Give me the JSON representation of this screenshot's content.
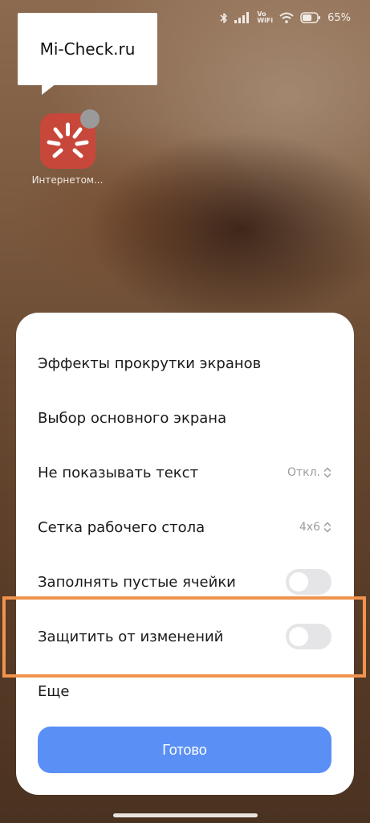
{
  "status_bar": {
    "vo_label": "Vo",
    "wifi_label": "WiFi",
    "battery_percent": "65",
    "battery_level": 0.65
  },
  "watermark": {
    "text": "Mi-Check.ru"
  },
  "app": {
    "label": "Интернетом..."
  },
  "settings_sheet": {
    "items": [
      {
        "label": "Эффекты прокрутки экранов"
      },
      {
        "label": "Выбор основного экрана"
      },
      {
        "label": "Не показывать текст",
        "value": "Откл."
      },
      {
        "label": "Сетка рабочего стола",
        "value": "4x6"
      },
      {
        "label": "Заполнять пустые ячейки",
        "toggle": false
      },
      {
        "label": "Защитить от изменений",
        "toggle": false
      },
      {
        "label": "Еще"
      }
    ],
    "done_label": "Готово"
  },
  "colors": {
    "accent": "#5a8ff6",
    "highlight": "#f0934e",
    "app_icon": "#c7473a"
  }
}
